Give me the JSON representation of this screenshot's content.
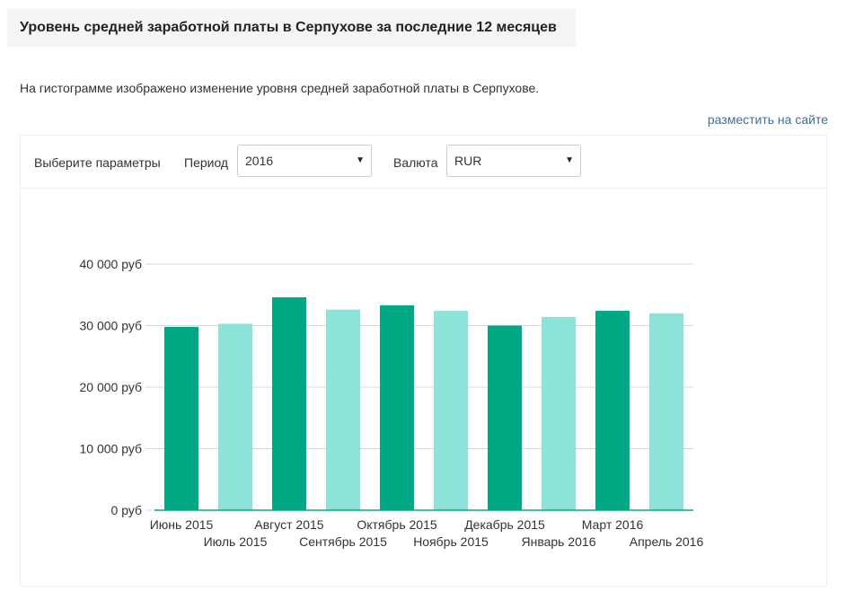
{
  "page": {
    "title": "Уровень средней заработной платы в Серпухове за последние 12 месяцев",
    "description": "На гистограмме изображено изменение уровня средней заработной платы в Серпухове.",
    "embed_link": "разместить на сайте"
  },
  "params": {
    "label": "Выберите параметры",
    "period_label": "Период",
    "period_value": "2016",
    "currency_label": "Валюта",
    "currency_value": "RUR",
    "dropdown_icon": "triangle-down-icon"
  },
  "chart_data": {
    "type": "bar",
    "categories": [
      "Июнь 2015",
      "Июль 2015",
      "Август 2015",
      "Сентябрь 2015",
      "Октябрь 2015",
      "Ноябрь 2015",
      "Декабрь 2015",
      "Январь 2016",
      "Март 2016",
      "Апрель 2016"
    ],
    "values": [
      29800,
      30300,
      34600,
      32600,
      33300,
      32400,
      30000,
      31400,
      32400,
      32000
    ],
    "ylim": [
      0,
      40000
    ],
    "yticks": [
      "0 руб",
      "10 000 руб",
      "20 000 руб",
      "30 000 руб",
      "40 000 руб"
    ],
    "grid": true,
    "colors": [
      "#00a884",
      "#8de3d7"
    ]
  }
}
